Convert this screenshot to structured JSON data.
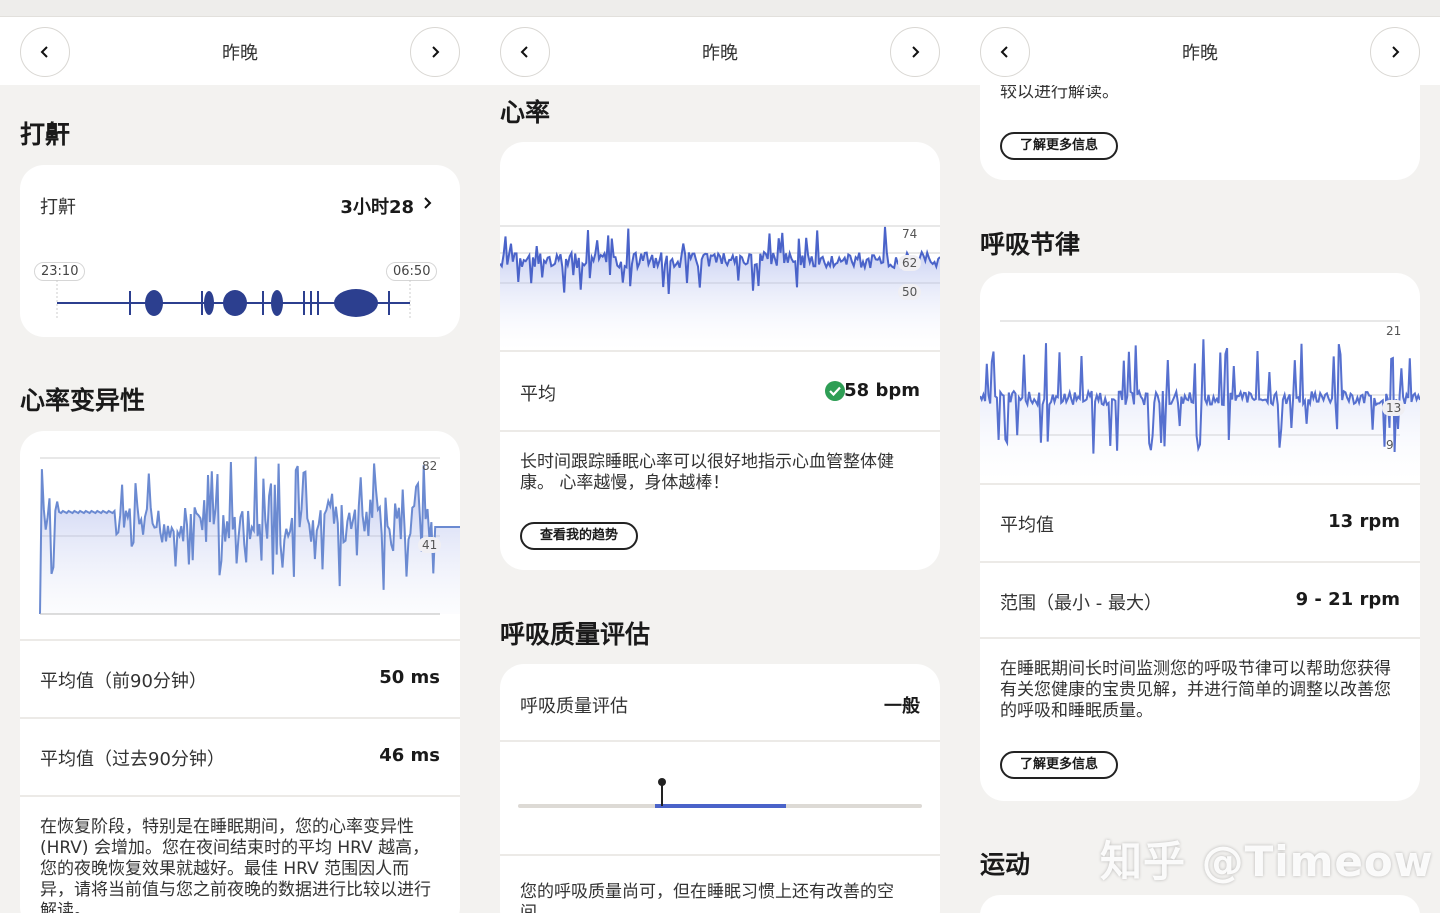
{
  "nav": {
    "title": "昨晚"
  },
  "panel1": {
    "snore": {
      "section_title": "打鼾",
      "label": "打鼾",
      "value": "3小时28",
      "start_time": "23:10",
      "end_time": "06:50"
    },
    "hrv": {
      "section_title": "心率变异性",
      "tick_high": "82",
      "tick_low": "41",
      "avg_first_label": "平均值（前90分钟）",
      "avg_first_value": "50 ms",
      "avg_last_label": "平均值（过去90分钟）",
      "avg_last_value": "46 ms",
      "description": "在恢复阶段，特别是在睡眠期间，您的心率变异性 (HRV) 会增加。您在夜间结束时的平均 HRV 越高，您的夜晚恢复效果就越好。最佳 HRV 范围因人而异，请将当前值与您之前夜晚的数据进行比较以进行解读。"
    }
  },
  "panel2": {
    "heart_rate": {
      "section_title": "心率",
      "tick_74": "74",
      "tick_62": "62",
      "tick_50": "50",
      "avg_label": "平均",
      "avg_value": "58 bpm",
      "description": "长时间跟踪睡眠心率可以很好地指示心血管整体健康。 心率越慢，身体越棒！",
      "button": "查看我的趋势"
    },
    "breathing_quality": {
      "section_title": "呼吸质量评估",
      "label": "呼吸质量评估",
      "value": "一般",
      "description": "您的呼吸质量尚可，但在睡眠习惯上还有改善的空间。"
    }
  },
  "panel3": {
    "top_text": "较以进行解读。",
    "learn_more_1": "了解更多信息",
    "breathing_rhythm": {
      "section_title": "呼吸节律",
      "tick_21": "21",
      "tick_13": "13",
      "tick_9": "9",
      "avg_label": "平均值",
      "avg_value": "13 rpm",
      "range_label": "范围（最小 - 最大）",
      "range_value": "9 - 21 rpm",
      "description": "在睡眠期间长时间监测您的呼吸节律可以帮助您获得有关您健康的宝贵见解，并进行简单的调整以改善您的呼吸和睡眠质量。",
      "learn_more": "了解更多信息"
    },
    "exercise": {
      "section_title": "运动"
    }
  },
  "watermark": "知乎 @Timeow",
  "colors": {
    "accent": "#4a63c9",
    "check": "#2e9e55",
    "background": "#f3f2f0"
  }
}
